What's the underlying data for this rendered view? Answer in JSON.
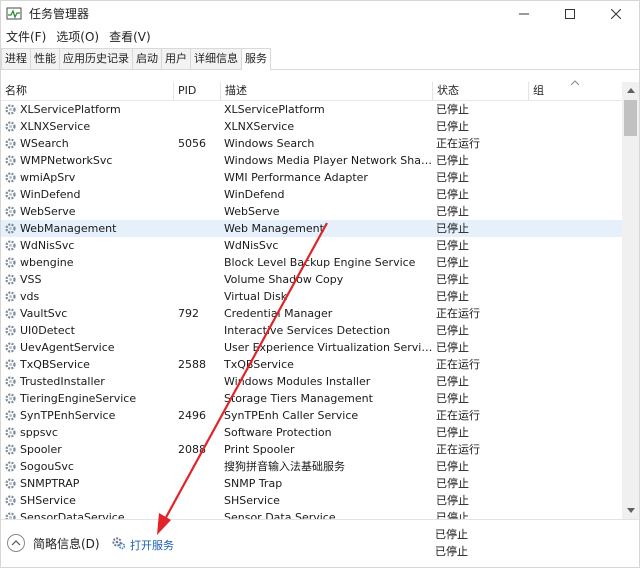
{
  "window": {
    "title": "任务管理器",
    "controls": [
      "minimize-icon",
      "maximize-icon",
      "close-icon"
    ]
  },
  "menu": [
    "文件(F)",
    "选项(O)",
    "查看(V)"
  ],
  "tabs": [
    "进程",
    "性能",
    "应用历史记录",
    "启动",
    "用户",
    "详细信息",
    "服务"
  ],
  "active_tab": "服务",
  "columns": {
    "name": "名称",
    "pid": "PID",
    "desc": "描述",
    "status": "状态",
    "group": "组"
  },
  "rows": [
    {
      "name": "XLServicePlatform",
      "pid": "",
      "desc": "XLServicePlatform",
      "status": "已停止"
    },
    {
      "name": "XLNXService",
      "pid": "",
      "desc": "XLNXService",
      "status": "已停止"
    },
    {
      "name": "WSearch",
      "pid": "5056",
      "desc": "Windows Search",
      "status": "正在运行"
    },
    {
      "name": "WMPNetworkSvc",
      "pid": "",
      "desc": "Windows Media Player Network Sharing ...",
      "status": "已停止"
    },
    {
      "name": "wmiApSrv",
      "pid": "",
      "desc": "WMI Performance Adapter",
      "status": "已停止"
    },
    {
      "name": "WinDefend",
      "pid": "",
      "desc": "WinDefend",
      "status": "已停止"
    },
    {
      "name": "WebServe",
      "pid": "",
      "desc": "WebServe",
      "status": "已停止"
    },
    {
      "name": "WebManagement",
      "pid": "",
      "desc": "Web Management",
      "status": "已停止",
      "selected": true
    },
    {
      "name": "WdNisSvc",
      "pid": "",
      "desc": "WdNisSvc",
      "status": "已停止"
    },
    {
      "name": "wbengine",
      "pid": "",
      "desc": "Block Level Backup Engine Service",
      "status": "已停止"
    },
    {
      "name": "VSS",
      "pid": "",
      "desc": "Volume Shadow Copy",
      "status": "已停止"
    },
    {
      "name": "vds",
      "pid": "",
      "desc": "Virtual Disk",
      "status": "已停止"
    },
    {
      "name": "VaultSvc",
      "pid": "792",
      "desc": "Credential Manager",
      "status": "正在运行"
    },
    {
      "name": "UI0Detect",
      "pid": "",
      "desc": "Interactive Services Detection",
      "status": "已停止"
    },
    {
      "name": "UevAgentService",
      "pid": "",
      "desc": "User Experience Virtualization Service",
      "status": "已停止"
    },
    {
      "name": "TxQBService",
      "pid": "2588",
      "desc": "TxQBService",
      "status": "正在运行"
    },
    {
      "name": "TrustedInstaller",
      "pid": "",
      "desc": "Windows Modules Installer",
      "status": "已停止"
    },
    {
      "name": "TieringEngineService",
      "pid": "",
      "desc": "Storage Tiers Management",
      "status": "已停止"
    },
    {
      "name": "SynTPEnhService",
      "pid": "2496",
      "desc": "SynTPEnh Caller Service",
      "status": "正在运行"
    },
    {
      "name": "sppsvc",
      "pid": "",
      "desc": "Software Protection",
      "status": "已停止"
    },
    {
      "name": "Spooler",
      "pid": "2088",
      "desc": "Print Spooler",
      "status": "正在运行"
    },
    {
      "name": "SogouSvc",
      "pid": "",
      "desc": "搜狗拼音输入法基础服务",
      "status": "已停止"
    },
    {
      "name": "SNMPTRAP",
      "pid": "",
      "desc": "SNMP Trap",
      "status": "已停止"
    },
    {
      "name": "SHService",
      "pid": "",
      "desc": "SHService",
      "status": "已停止"
    },
    {
      "name": "SensorDataService",
      "pid": "",
      "desc": "Sensor Data Service",
      "status": "已停止"
    }
  ],
  "footer": {
    "brief_label": "简略信息(D)",
    "open_services_label": "打开服务",
    "trailing_status": [
      "已停止",
      "已停止"
    ]
  },
  "colors": {
    "selected_row": "#e5f0fb",
    "link": "#1a5fb4",
    "annotation_arrow": "#e0242a"
  }
}
